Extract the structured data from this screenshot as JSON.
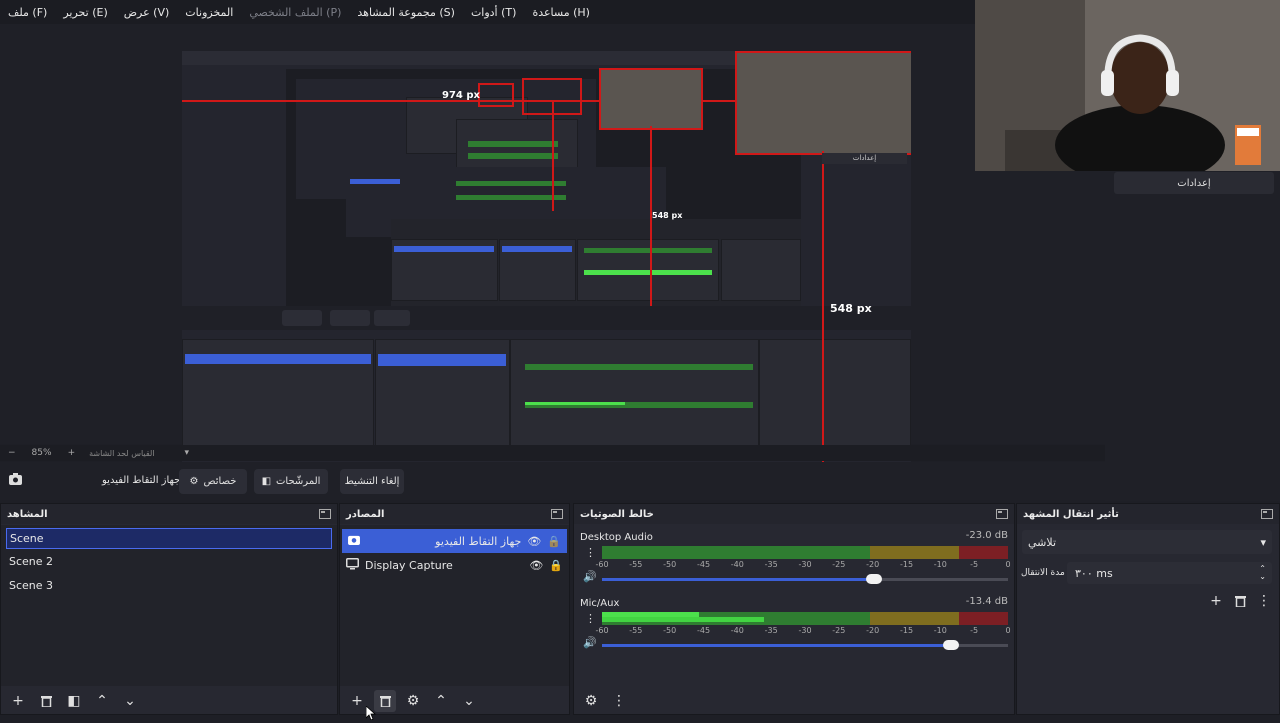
{
  "menu": {
    "items": [
      {
        "label": "ملف (F)"
      },
      {
        "label": "تحرير (E)"
      },
      {
        "label": "عرض (V)"
      },
      {
        "label": "المخزونات"
      },
      {
        "label": "الملف الشخصي (P)",
        "dim": true
      },
      {
        "label": "مجموعة المشاهد (S)"
      },
      {
        "label": "أدوات (T)"
      },
      {
        "label": "مساعدة (H)"
      }
    ]
  },
  "preview": {
    "label_974": "974 px",
    "label_548a": "548 px",
    "label_548b": "548 px",
    "mini_settings": "إعدادات"
  },
  "right_dock": {
    "settings_label": "إعدادات"
  },
  "zoom": {
    "minus": "−",
    "value": "85%",
    "plus": "+",
    "fit_label": "القياس لحد الشاشة"
  },
  "controls": {
    "camera_source": "جهاز التقاط الفيديو",
    "properties": "خصائص",
    "filters": "المرشّحات",
    "deactivate": "إلغاء التنشيط"
  },
  "scenes": {
    "title": "المشاهد",
    "items": [
      "Scene",
      "Scene 2",
      "Scene 3"
    ]
  },
  "sources": {
    "title": "المصادر",
    "items": [
      {
        "label": "جهاز التقاط الفيديو",
        "icon": "camera-icon",
        "selected": true
      },
      {
        "label": "Display Capture",
        "icon": "monitor-icon",
        "selected": false
      }
    ]
  },
  "mixer": {
    "title": "خالط الصوتيات",
    "scale": [
      "-60",
      "-55",
      "-50",
      "-45",
      "-40",
      "-35",
      "-30",
      "-25",
      "-20",
      "-15",
      "-10",
      "-5",
      "0"
    ],
    "channels": [
      {
        "name": "Desktop Audio",
        "db": "-23.0 dB",
        "fader": 0.67
      },
      {
        "name": "Mic/Aux",
        "db": "-13.4 dB",
        "fader": 0.86
      }
    ]
  },
  "transition": {
    "title": "تأثير انتقال المشهد",
    "type": "تلاشي",
    "duration_label": "مدة الانتقال",
    "duration_value": "٣٠٠ ms"
  },
  "colors": {
    "accent": "#3b5fd6",
    "red_guides": "#d01818",
    "meter_green": "#2f7d31",
    "meter_yellow": "#7f6d1f",
    "meter_red": "#7c1f24"
  }
}
